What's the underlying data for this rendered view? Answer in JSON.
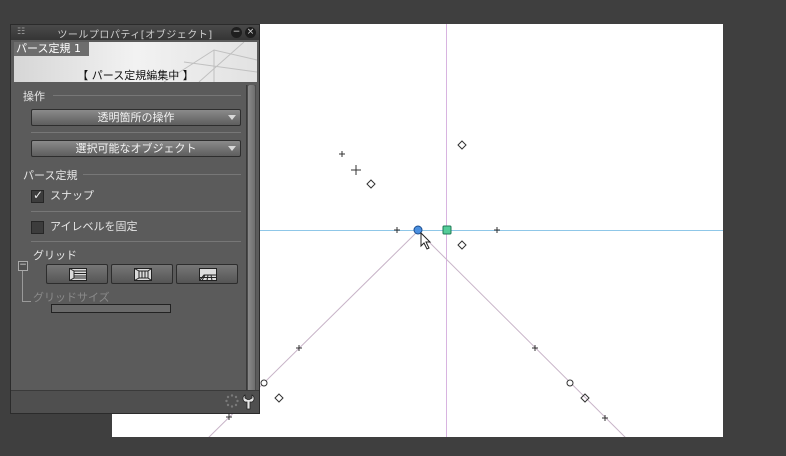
{
  "panel": {
    "title": "ツールプロパティ[オブジェクト]",
    "ruler_tag": "パース定規 1",
    "edit_status": "【 パース定規編集中 】",
    "operation_label": "操作",
    "dropdown1": "透明箇所の操作",
    "dropdown2": "選択可能なオブジェクト",
    "perspective_label": "パース定規",
    "snap_label": "スナップ",
    "snap_checked": true,
    "eyelevel_label": "アイレベルを固定",
    "eyelevel_checked": false,
    "grid_label": "グリッド",
    "grid_size_label": "グリッドサイズ",
    "grid_buttons": [
      "grid-left-plane-icon",
      "grid-right-plane-icon",
      "grid-floor-plane-icon"
    ],
    "title_buttons": {
      "minimize": "−",
      "close": "×"
    }
  },
  "canvas": {
    "background": "#ffffff",
    "guide_colors": {
      "horizon": "#8fc7e8",
      "vertical": "#d8b4e0",
      "perspective": "#c8b4c8"
    },
    "handle_colors": {
      "vanishing_point": "#4a8fe0",
      "eye_level_handle": "#55cc99"
    }
  }
}
